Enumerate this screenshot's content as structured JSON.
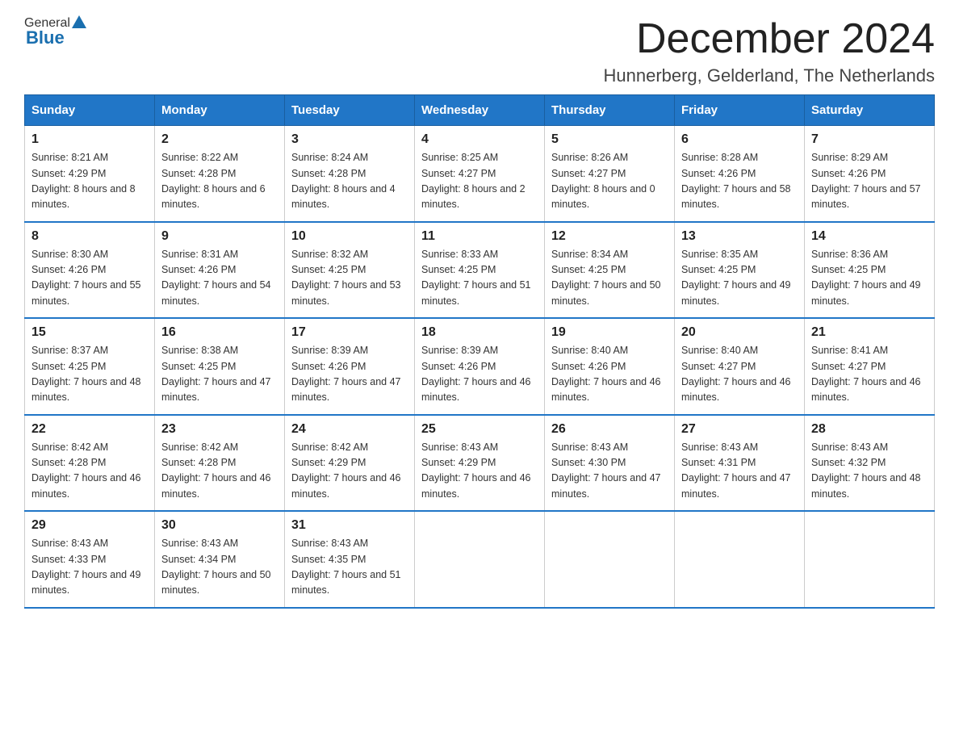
{
  "header": {
    "logo_general": "General",
    "logo_blue": "Blue",
    "month_title": "December 2024",
    "location": "Hunnerberg, Gelderland, The Netherlands"
  },
  "weekdays": [
    "Sunday",
    "Monday",
    "Tuesday",
    "Wednesday",
    "Thursday",
    "Friday",
    "Saturday"
  ],
  "weeks": [
    [
      {
        "day": "1",
        "sunrise": "8:21 AM",
        "sunset": "4:29 PM",
        "daylight": "8 hours and 8 minutes."
      },
      {
        "day": "2",
        "sunrise": "8:22 AM",
        "sunset": "4:28 PM",
        "daylight": "8 hours and 6 minutes."
      },
      {
        "day": "3",
        "sunrise": "8:24 AM",
        "sunset": "4:28 PM",
        "daylight": "8 hours and 4 minutes."
      },
      {
        "day": "4",
        "sunrise": "8:25 AM",
        "sunset": "4:27 PM",
        "daylight": "8 hours and 2 minutes."
      },
      {
        "day": "5",
        "sunrise": "8:26 AM",
        "sunset": "4:27 PM",
        "daylight": "8 hours and 0 minutes."
      },
      {
        "day": "6",
        "sunrise": "8:28 AM",
        "sunset": "4:26 PM",
        "daylight": "7 hours and 58 minutes."
      },
      {
        "day": "7",
        "sunrise": "8:29 AM",
        "sunset": "4:26 PM",
        "daylight": "7 hours and 57 minutes."
      }
    ],
    [
      {
        "day": "8",
        "sunrise": "8:30 AM",
        "sunset": "4:26 PM",
        "daylight": "7 hours and 55 minutes."
      },
      {
        "day": "9",
        "sunrise": "8:31 AM",
        "sunset": "4:26 PM",
        "daylight": "7 hours and 54 minutes."
      },
      {
        "day": "10",
        "sunrise": "8:32 AM",
        "sunset": "4:25 PM",
        "daylight": "7 hours and 53 minutes."
      },
      {
        "day": "11",
        "sunrise": "8:33 AM",
        "sunset": "4:25 PM",
        "daylight": "7 hours and 51 minutes."
      },
      {
        "day": "12",
        "sunrise": "8:34 AM",
        "sunset": "4:25 PM",
        "daylight": "7 hours and 50 minutes."
      },
      {
        "day": "13",
        "sunrise": "8:35 AM",
        "sunset": "4:25 PM",
        "daylight": "7 hours and 49 minutes."
      },
      {
        "day": "14",
        "sunrise": "8:36 AM",
        "sunset": "4:25 PM",
        "daylight": "7 hours and 49 minutes."
      }
    ],
    [
      {
        "day": "15",
        "sunrise": "8:37 AM",
        "sunset": "4:25 PM",
        "daylight": "7 hours and 48 minutes."
      },
      {
        "day": "16",
        "sunrise": "8:38 AM",
        "sunset": "4:25 PM",
        "daylight": "7 hours and 47 minutes."
      },
      {
        "day": "17",
        "sunrise": "8:39 AM",
        "sunset": "4:26 PM",
        "daylight": "7 hours and 47 minutes."
      },
      {
        "day": "18",
        "sunrise": "8:39 AM",
        "sunset": "4:26 PM",
        "daylight": "7 hours and 46 minutes."
      },
      {
        "day": "19",
        "sunrise": "8:40 AM",
        "sunset": "4:26 PM",
        "daylight": "7 hours and 46 minutes."
      },
      {
        "day": "20",
        "sunrise": "8:40 AM",
        "sunset": "4:27 PM",
        "daylight": "7 hours and 46 minutes."
      },
      {
        "day": "21",
        "sunrise": "8:41 AM",
        "sunset": "4:27 PM",
        "daylight": "7 hours and 46 minutes."
      }
    ],
    [
      {
        "day": "22",
        "sunrise": "8:42 AM",
        "sunset": "4:28 PM",
        "daylight": "7 hours and 46 minutes."
      },
      {
        "day": "23",
        "sunrise": "8:42 AM",
        "sunset": "4:28 PM",
        "daylight": "7 hours and 46 minutes."
      },
      {
        "day": "24",
        "sunrise": "8:42 AM",
        "sunset": "4:29 PM",
        "daylight": "7 hours and 46 minutes."
      },
      {
        "day": "25",
        "sunrise": "8:43 AM",
        "sunset": "4:29 PM",
        "daylight": "7 hours and 46 minutes."
      },
      {
        "day": "26",
        "sunrise": "8:43 AM",
        "sunset": "4:30 PM",
        "daylight": "7 hours and 47 minutes."
      },
      {
        "day": "27",
        "sunrise": "8:43 AM",
        "sunset": "4:31 PM",
        "daylight": "7 hours and 47 minutes."
      },
      {
        "day": "28",
        "sunrise": "8:43 AM",
        "sunset": "4:32 PM",
        "daylight": "7 hours and 48 minutes."
      }
    ],
    [
      {
        "day": "29",
        "sunrise": "8:43 AM",
        "sunset": "4:33 PM",
        "daylight": "7 hours and 49 minutes."
      },
      {
        "day": "30",
        "sunrise": "8:43 AM",
        "sunset": "4:34 PM",
        "daylight": "7 hours and 50 minutes."
      },
      {
        "day": "31",
        "sunrise": "8:43 AM",
        "sunset": "4:35 PM",
        "daylight": "7 hours and 51 minutes."
      },
      null,
      null,
      null,
      null
    ]
  ]
}
